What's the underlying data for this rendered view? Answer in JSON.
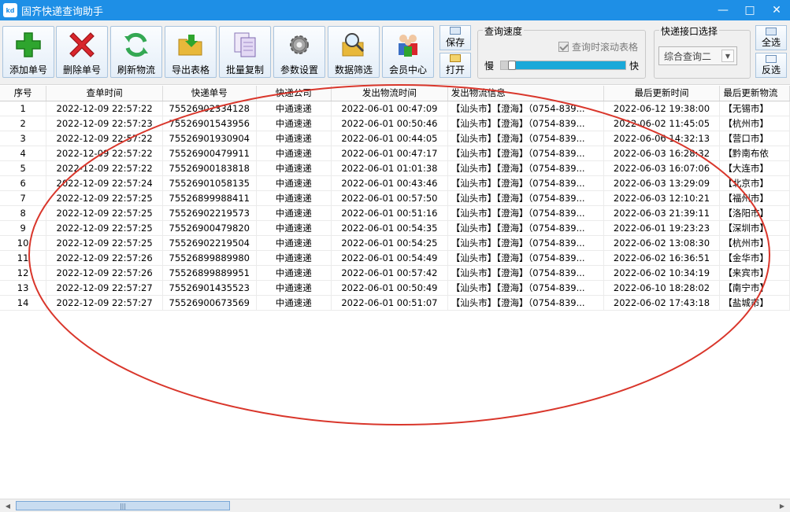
{
  "window": {
    "title": "固齐快递查询助手",
    "icon_text": "kd",
    "controls": [
      "minimize-icon",
      "maximize-icon",
      "close-icon"
    ]
  },
  "toolbar": {
    "buttons": [
      {
        "label": "添加单号",
        "icon": "plus-icon",
        "color": "#2ea52e"
      },
      {
        "label": "删除单号",
        "icon": "red-x-icon",
        "color": "#d9262c"
      },
      {
        "label": "刷新物流",
        "icon": "refresh-icon",
        "color": "#34a853"
      },
      {
        "label": "导出表格",
        "icon": "folder-export-icon",
        "color": "#e8b83a"
      },
      {
        "label": "批量复制",
        "icon": "copy-docs-icon",
        "color": "#a08ac8"
      },
      {
        "label": "参数设置",
        "icon": "gear-icon",
        "color": "#7d7d7d"
      },
      {
        "label": "数据筛选",
        "icon": "search-filter-icon",
        "color": "#e8b83a"
      },
      {
        "label": "会员中心",
        "icon": "members-icon",
        "color": "#d9262c"
      }
    ],
    "save_label": "保存",
    "open_label": "打开",
    "speed": {
      "title": "查询速度",
      "checkbox_label": "查询时滚动表格",
      "slow_label": "慢",
      "fast_label": "快",
      "level": 0.06
    },
    "interface": {
      "title": "快递接口选择",
      "selected": "综合查询二"
    },
    "select_all_label": "全选",
    "invert_label": "反选"
  },
  "table": {
    "headers": [
      "序号",
      "查单时间",
      "快递单号",
      "快递公司",
      "发出物流时间",
      "发出物流信息",
      "最后更新时间",
      "最后更新物流"
    ],
    "rows": [
      [
        "1",
        "2022-12-09 22:57:22",
        "75526902334128",
        "中通速递",
        "2022-06-01 00:47:09",
        "【汕头市】【澄海】（0754-839...",
        "2022-06-12 19:38:00",
        "【无锡市】"
      ],
      [
        "2",
        "2022-12-09 22:57:23",
        "75526901543956",
        "中通速递",
        "2022-06-01 00:50:46",
        "【汕头市】【澄海】（0754-839...",
        "2022-06-02 11:45:05",
        "【杭州市】"
      ],
      [
        "3",
        "2022-12-09 22:57:22",
        "75526901930904",
        "中通速递",
        "2022-06-01 00:44:05",
        "【汕头市】【澄海】（0754-839...",
        "2022-06-06 14:32:13",
        "【营口市】"
      ],
      [
        "4",
        "2022-12-09 22:57:22",
        "75526900479911",
        "中通速递",
        "2022-06-01 00:47:17",
        "【汕头市】【澄海】（0754-839...",
        "2022-06-03 16:28:32",
        "【黔南布依"
      ],
      [
        "5",
        "2022-12-09 22:57:22",
        "75526900183818",
        "中通速递",
        "2022-06-01 01:01:38",
        "【汕头市】【澄海】（0754-839...",
        "2022-06-03 16:07:06",
        "【大连市】"
      ],
      [
        "6",
        "2022-12-09 22:57:24",
        "75526901058135",
        "中通速递",
        "2022-06-01 00:43:46",
        "【汕头市】【澄海】（0754-839...",
        "2022-06-03 13:29:09",
        "【北京市】"
      ],
      [
        "7",
        "2022-12-09 22:57:25",
        "75526899988411",
        "中通速递",
        "2022-06-01 00:57:50",
        "【汕头市】【澄海】（0754-839...",
        "2022-06-03 12:10:21",
        "【福州市】"
      ],
      [
        "8",
        "2022-12-09 22:57:25",
        "75526902219573",
        "中通速递",
        "2022-06-01 00:51:16",
        "【汕头市】【澄海】（0754-839...",
        "2022-06-03 21:39:11",
        "【洛阳市】"
      ],
      [
        "9",
        "2022-12-09 22:57:25",
        "75526900479820",
        "中通速递",
        "2022-06-01 00:54:35",
        "【汕头市】【澄海】（0754-839...",
        "2022-06-01 19:23:23",
        "【深圳市】"
      ],
      [
        "10",
        "2022-12-09 22:57:25",
        "75526902219504",
        "中通速递",
        "2022-06-01 00:54:25",
        "【汕头市】【澄海】（0754-839...",
        "2022-06-02 13:08:30",
        "【杭州市】"
      ],
      [
        "11",
        "2022-12-09 22:57:26",
        "75526899889980",
        "中通速递",
        "2022-06-01 00:54:49",
        "【汕头市】【澄海】（0754-839...",
        "2022-06-02 16:36:51",
        "【金华市】"
      ],
      [
        "12",
        "2022-12-09 22:57:26",
        "75526899889951",
        "中通速递",
        "2022-06-01 00:57:42",
        "【汕头市】【澄海】（0754-839...",
        "2022-06-02 10:34:19",
        "【来宾市】"
      ],
      [
        "13",
        "2022-12-09 22:57:27",
        "75526901435523",
        "中通速递",
        "2022-06-01 00:50:49",
        "【汕头市】【澄海】（0754-839...",
        "2022-06-10 18:28:02",
        "【南宁市】"
      ],
      [
        "14",
        "2022-12-09 22:57:27",
        "75526900673569",
        "中通速递",
        "2022-06-01 00:51:07",
        "【汕头市】【澄海】（0754-839...",
        "2022-06-02 17:43:18",
        "【盐城市】"
      ]
    ]
  },
  "annotation": {
    "shape": "ellipse",
    "color": "#d9362b"
  }
}
